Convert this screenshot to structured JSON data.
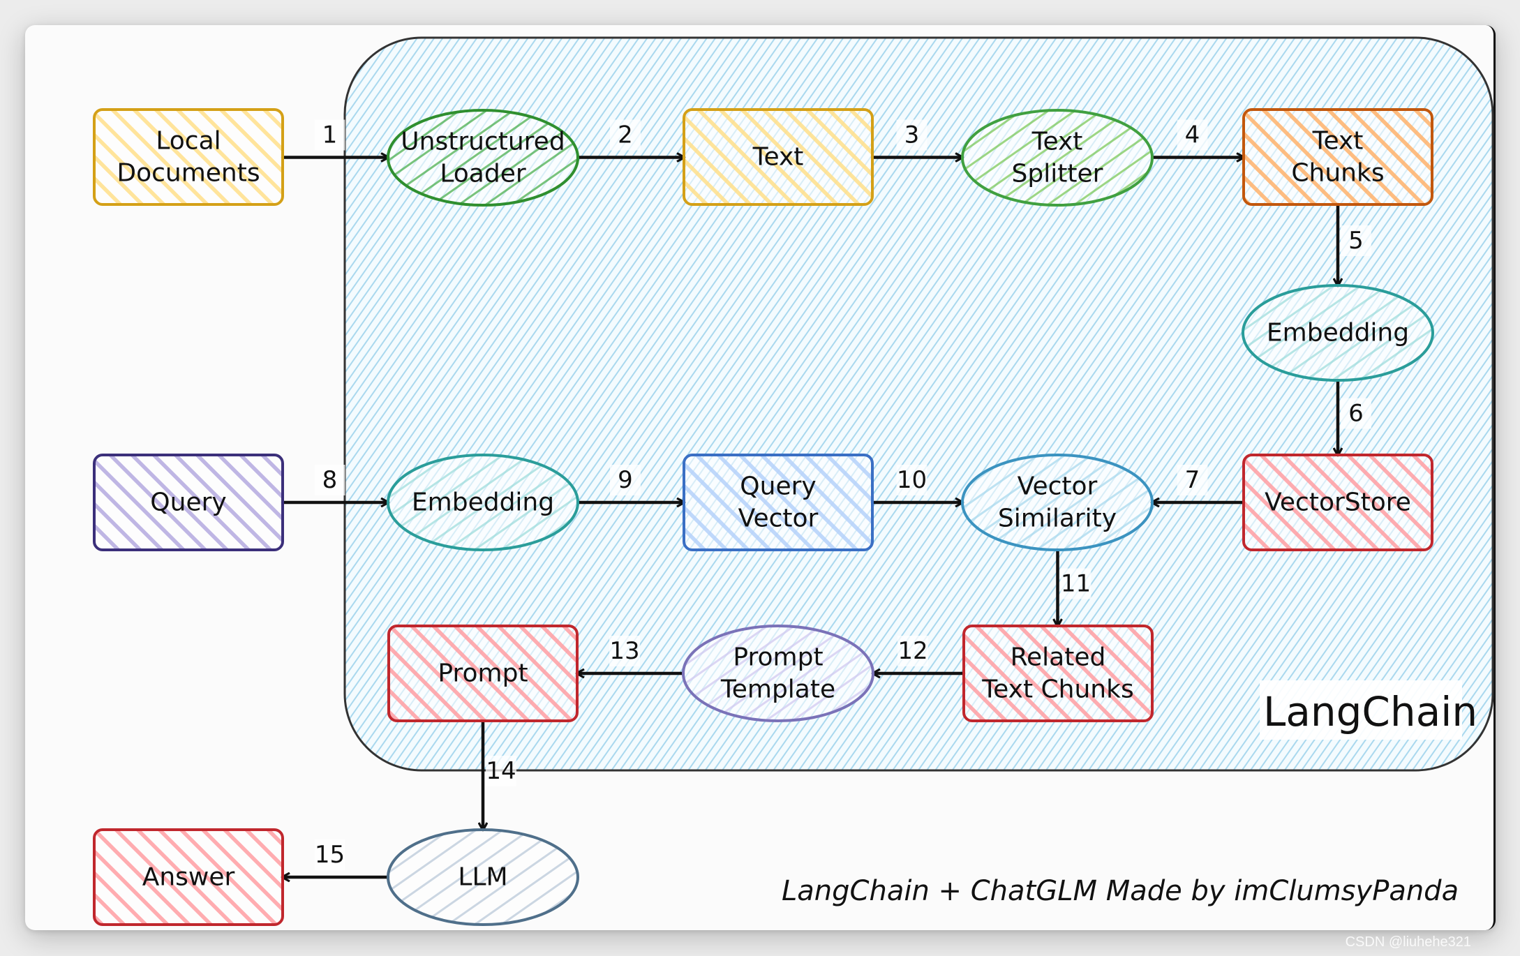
{
  "diagram": {
    "frame_title": "LangChain",
    "credit": "LangChain + ChatGLM Made by imClumsyPanda",
    "watermark": "CSDN @liuhehe321",
    "frame_colors": {
      "fill": "#d6edf7",
      "hatch": "#a9d8ee",
      "stroke": "#333333"
    },
    "nodes": [
      {
        "id": "local-documents",
        "label": [
          "Local",
          "Documents"
        ],
        "shape": "rect",
        "stroke": "#d4a017",
        "fill": "#ffe08a",
        "inside_frame": false
      },
      {
        "id": "unstructured-loader",
        "label": [
          "Unstructured",
          "Loader"
        ],
        "shape": "ellipse",
        "stroke": "#2f8f2f",
        "fill": "#4caf50",
        "inside_frame": true
      },
      {
        "id": "text",
        "label": [
          "Text"
        ],
        "shape": "rect",
        "stroke": "#d4a017",
        "fill": "#ffe08a",
        "inside_frame": true
      },
      {
        "id": "text-splitter",
        "label": [
          "Text",
          "Splitter"
        ],
        "shape": "ellipse",
        "stroke": "#40a040",
        "fill": "#7cc95a",
        "inside_frame": true
      },
      {
        "id": "text-chunks",
        "label": [
          "Text",
          "Chunks"
        ],
        "shape": "rect",
        "stroke": "#c2570c",
        "fill": "#ffb26b",
        "inside_frame": true
      },
      {
        "id": "embedding-docs",
        "label": [
          "Embedding"
        ],
        "shape": "ellipse",
        "stroke": "#2a9d9a",
        "fill": "#9fdcdc",
        "inside_frame": true
      },
      {
        "id": "vectorstore",
        "label": [
          "VectorStore"
        ],
        "shape": "rect",
        "stroke": "#c0272d",
        "fill": "#ff9ea2",
        "inside_frame": true
      },
      {
        "id": "query",
        "label": [
          "Query"
        ],
        "shape": "rect",
        "stroke": "#3b2f7a",
        "fill": "#b4a9e0",
        "inside_frame": false
      },
      {
        "id": "embedding-query",
        "label": [
          "Embedding"
        ],
        "shape": "ellipse",
        "stroke": "#2a9d9a",
        "fill": "#9fdcdc",
        "inside_frame": true
      },
      {
        "id": "query-vector",
        "label": [
          "Query",
          "Vector"
        ],
        "shape": "rect",
        "stroke": "#3a6fc4",
        "fill": "#b5d1fb",
        "inside_frame": true
      },
      {
        "id": "vector-similarity",
        "label": [
          "Vector",
          "Similarity"
        ],
        "shape": "ellipse",
        "stroke": "#3b93c0",
        "fill": "#a8d8ee",
        "inside_frame": true
      },
      {
        "id": "related-text-chunks",
        "label": [
          "Related",
          "Text Chunks"
        ],
        "shape": "rect",
        "stroke": "#c0272d",
        "fill": "#ff9ea2",
        "inside_frame": true
      },
      {
        "id": "prompt-template",
        "label": [
          "Prompt",
          "Template"
        ],
        "shape": "ellipse",
        "stroke": "#7a72b8",
        "fill": "#d0c8f0",
        "inside_frame": true
      },
      {
        "id": "prompt",
        "label": [
          "Prompt"
        ],
        "shape": "rect",
        "stroke": "#c0272d",
        "fill": "#ff9ea2",
        "inside_frame": true
      },
      {
        "id": "llm",
        "label": [
          "LLM"
        ],
        "shape": "ellipse",
        "stroke": "#4f6f8a",
        "fill": "#b9c9d8",
        "inside_frame": false
      },
      {
        "id": "answer",
        "label": [
          "Answer"
        ],
        "shape": "rect",
        "stroke": "#c0272d",
        "fill": "#ff9ea2",
        "inside_frame": false
      }
    ],
    "edges": [
      {
        "step": "1",
        "from": "local-documents",
        "to": "unstructured-loader"
      },
      {
        "step": "2",
        "from": "unstructured-loader",
        "to": "text"
      },
      {
        "step": "3",
        "from": "text",
        "to": "text-splitter"
      },
      {
        "step": "4",
        "from": "text-splitter",
        "to": "text-chunks"
      },
      {
        "step": "5",
        "from": "text-chunks",
        "to": "embedding-docs"
      },
      {
        "step": "6",
        "from": "embedding-docs",
        "to": "vectorstore"
      },
      {
        "step": "7",
        "from": "vectorstore",
        "to": "vector-similarity"
      },
      {
        "step": "8",
        "from": "query",
        "to": "embedding-query"
      },
      {
        "step": "9",
        "from": "embedding-query",
        "to": "query-vector"
      },
      {
        "step": "10",
        "from": "query-vector",
        "to": "vector-similarity"
      },
      {
        "step": "11",
        "from": "vector-similarity",
        "to": "related-text-chunks"
      },
      {
        "step": "12",
        "from": "related-text-chunks",
        "to": "prompt-template"
      },
      {
        "step": "13",
        "from": "prompt-template",
        "to": "prompt"
      },
      {
        "step": "14",
        "from": "prompt",
        "to": "llm"
      },
      {
        "step": "15",
        "from": "llm",
        "to": "answer"
      }
    ]
  }
}
